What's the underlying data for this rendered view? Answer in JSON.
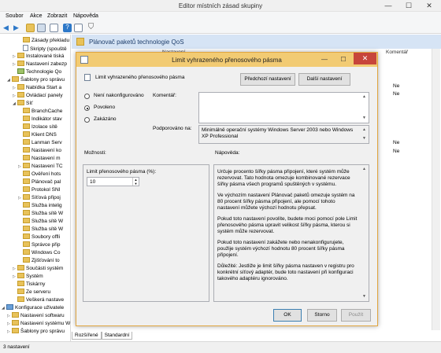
{
  "window": {
    "title": "Editor místních zásad skupiny",
    "minimize": "—",
    "maximize": "☐",
    "close": "✕"
  },
  "menu": [
    "Soubor",
    "Akce",
    "Zobrazit",
    "Nápověda"
  ],
  "tree": [
    {
      "label": "Zásady překladu",
      "indent": 3,
      "icon": "folder"
    },
    {
      "label": "Skripty (spouště",
      "indent": 3,
      "icon": "doc"
    },
    {
      "label": "Instalované tiská",
      "indent": 2,
      "expander": "▷",
      "icon": "folder"
    },
    {
      "label": "Nastavení zabezp",
      "indent": 2,
      "expander": "▷",
      "icon": "folder"
    },
    {
      "label": "Technologie Qo",
      "indent": 2,
      "icon": "chart"
    },
    {
      "label": "Šablony pro správu",
      "indent": 1,
      "expander": "◢",
      "icon": "folder"
    },
    {
      "label": "Nabídka Start a",
      "indent": 2,
      "expander": "▷",
      "icon": "folder"
    },
    {
      "label": "Ovládací panely",
      "indent": 2,
      "expander": "▷",
      "icon": "folder"
    },
    {
      "label": "Síť",
      "indent": 2,
      "expander": "◢",
      "icon": "folder"
    },
    {
      "label": "BranchCache",
      "indent": 3,
      "icon": "folder"
    },
    {
      "label": "Indikátor stav",
      "indent": 3,
      "icon": "folder"
    },
    {
      "label": "Izolace sítě",
      "indent": 3,
      "icon": "folder"
    },
    {
      "label": "Klient DNS",
      "indent": 3,
      "icon": "folder"
    },
    {
      "label": "Lanman Serv",
      "indent": 3,
      "icon": "folder"
    },
    {
      "label": "Nastavení ko",
      "indent": 3,
      "icon": "folder"
    },
    {
      "label": "Nastavení m",
      "indent": 3,
      "icon": "folder"
    },
    {
      "label": "Nastavení TC",
      "indent": 3,
      "expander": "▷",
      "icon": "folder"
    },
    {
      "label": "Ověření hots",
      "indent": 3,
      "icon": "folder"
    },
    {
      "label": "Plánovač pal",
      "indent": 3,
      "icon": "folder"
    },
    {
      "label": "Protokol SNI",
      "indent": 3,
      "icon": "folder"
    },
    {
      "label": "Síťová připoj",
      "indent": 3,
      "expander": "▷",
      "icon": "folder"
    },
    {
      "label": "Služba intelig",
      "indent": 3,
      "icon": "folder"
    },
    {
      "label": "Služba sítě W",
      "indent": 3,
      "icon": "folder"
    },
    {
      "label": "Služba sítě W",
      "indent": 3,
      "icon": "folder"
    },
    {
      "label": "Služba sítě W",
      "indent": 3,
      "icon": "folder"
    },
    {
      "label": "Soubory offli",
      "indent": 3,
      "icon": "folder"
    },
    {
      "label": "Správce přip",
      "indent": 3,
      "icon": "folder"
    },
    {
      "label": "Windows Co",
      "indent": 3,
      "icon": "folder"
    },
    {
      "label": "Zjišťování to",
      "indent": 3,
      "icon": "folder"
    },
    {
      "label": "Součásti systém",
      "indent": 2,
      "expander": "▷",
      "icon": "folder"
    },
    {
      "label": "Systém",
      "indent": 2,
      "expander": "▷",
      "icon": "folder"
    },
    {
      "label": "Tiskárny",
      "indent": 2,
      "icon": "folder"
    },
    {
      "label": "Ze serveru",
      "indent": 2,
      "icon": "folder"
    },
    {
      "label": "Veškerá nastave",
      "indent": 2,
      "icon": "folder"
    },
    {
      "label": "Konfigurace uživatele",
      "indent": 0,
      "expander": "◢",
      "icon": "user"
    },
    {
      "label": "Nastavení softwaru",
      "indent": 1,
      "expander": "▷",
      "icon": "folder"
    },
    {
      "label": "Nastavení systému W",
      "indent": 1,
      "expander": "▷",
      "icon": "folder"
    },
    {
      "label": "Šablony pro správu",
      "indent": 1,
      "expander": "▷",
      "icon": "folder"
    }
  ],
  "right_pane": {
    "title": "Plánovač paketů technologie QoS",
    "columns": [
      "Nastavení",
      "Komentář"
    ],
    "bg_values": [
      "Ne",
      "Ne",
      "Ne",
      "Ne"
    ],
    "tabs": [
      "Rozšířené",
      "Standardní"
    ]
  },
  "status": "3 nastavení",
  "dialog": {
    "title": "Limit vyhrazeného přenosového pásma",
    "setting_name": "Limit vyhrazeného přenosového pásma",
    "prev_button": "Předchozí nastavení",
    "next_button": "Další nastavení",
    "radios": [
      {
        "label": "Není nakonfigurováno",
        "selected": false
      },
      {
        "label": "Povoleno",
        "selected": true
      },
      {
        "label": "Zakázáno",
        "selected": false
      }
    ],
    "comment_label": "Komentář:",
    "supported_label": "Podporováno na:",
    "supported_text": "Minimálně operační systémy Windows Server 2003 nebo Windows XP Professional",
    "options_label": "Možnosti:",
    "help_label": "Nápověda:",
    "limit_label": "Limit přenosového pásma (%):",
    "limit_value": "10",
    "help_paragraphs": [
      "Určuje procento šířky pásma připojení, které systém může rezervovat. Tato hodnota omezuje kombinované rezervace šířky pásma všech programů spuštěných v systému.",
      "Ve výchozím nastavení Plánovač paketů omezuje systém na 80 procent šířky pásma připojení, ale pomocí tohoto nastavení můžete výchozí hodnotu přepsat.",
      "Pokud toto nastavení povolíte, budete moci pomocí pole Limit přenosového pásma upravit velikost šířky pásma, kterou si systém může rezervovat.",
      "Pokud toto nastavení zakážete nebo nenakonfigurujete, použije systém výchozí hodnotu 80 procent šířky pásma připojení.",
      "Důležité: Jestliže je limit šířky pásma nastaven v registru pro konkrétní síťový adaptér, bude toto nastavení při konfiguraci takového adaptéru ignorováno."
    ],
    "ok_button": "OK",
    "cancel_button": "Storno",
    "apply_button": "Použít"
  },
  "colors": {
    "dialog_titlebar": "#f2cb73",
    "dialog_border": "#e0a53f",
    "close_button": "#c7453a"
  }
}
